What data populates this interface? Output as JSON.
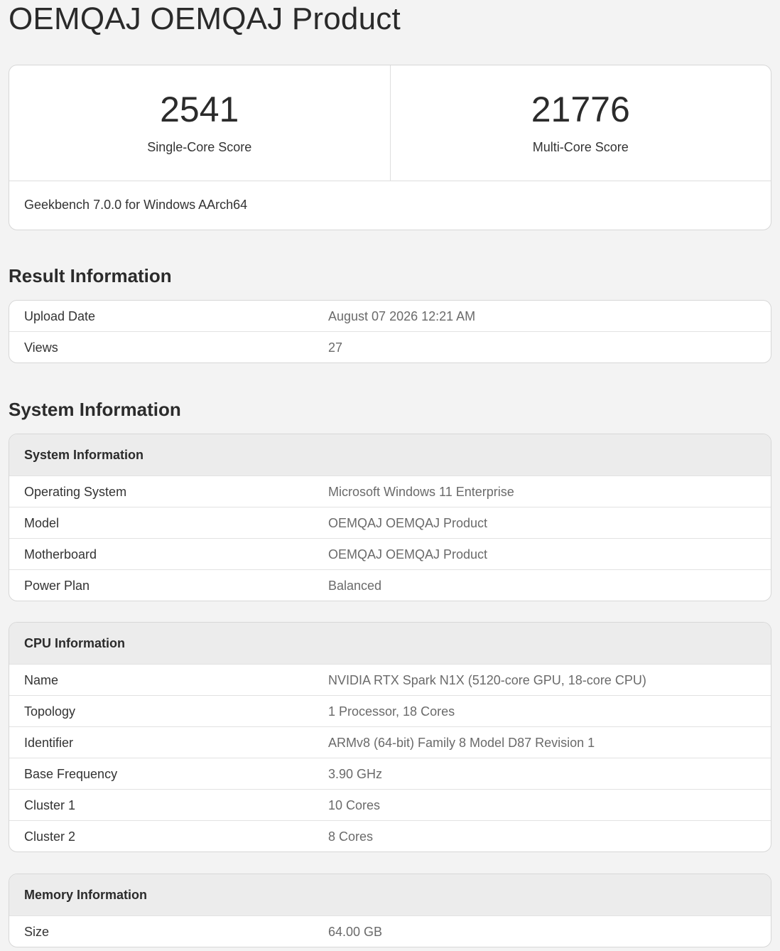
{
  "page": {
    "title": "OEMQAJ OEMQAJ Product"
  },
  "scores": {
    "single_core": {
      "value": "2541",
      "label": "Single-Core Score"
    },
    "multi_core": {
      "value": "21776",
      "label": "Multi-Core Score"
    },
    "version": "Geekbench 7.0.0 for Windows AArch64"
  },
  "result_information": {
    "title": "Result Information",
    "rows": [
      {
        "key": "Upload Date",
        "value": "August 07 2026 12:21 AM"
      },
      {
        "key": "Views",
        "value": "27"
      }
    ]
  },
  "system_information": {
    "title": "System Information",
    "system": {
      "header": "System Information",
      "rows": [
        {
          "key": "Operating System",
          "value": "Microsoft Windows 11 Enterprise"
        },
        {
          "key": "Model",
          "value": "OEMQAJ OEMQAJ Product"
        },
        {
          "key": "Motherboard",
          "value": "OEMQAJ OEMQAJ Product"
        },
        {
          "key": "Power Plan",
          "value": "Balanced"
        }
      ]
    },
    "cpu": {
      "header": "CPU Information",
      "rows": [
        {
          "key": "Name",
          "value": "NVIDIA RTX Spark N1X (5120-core GPU, 18-core CPU)"
        },
        {
          "key": "Topology",
          "value": "1 Processor, 18 Cores"
        },
        {
          "key": "Identifier",
          "value": "ARMv8 (64-bit) Family 8 Model D87 Revision 1"
        },
        {
          "key": "Base Frequency",
          "value": "3.90 GHz"
        },
        {
          "key": "Cluster 1",
          "value": "10 Cores"
        },
        {
          "key": "Cluster 2",
          "value": "8 Cores"
        }
      ]
    },
    "memory": {
      "header": "Memory Information",
      "rows": [
        {
          "key": "Size",
          "value": "64.00 GB"
        }
      ]
    }
  }
}
